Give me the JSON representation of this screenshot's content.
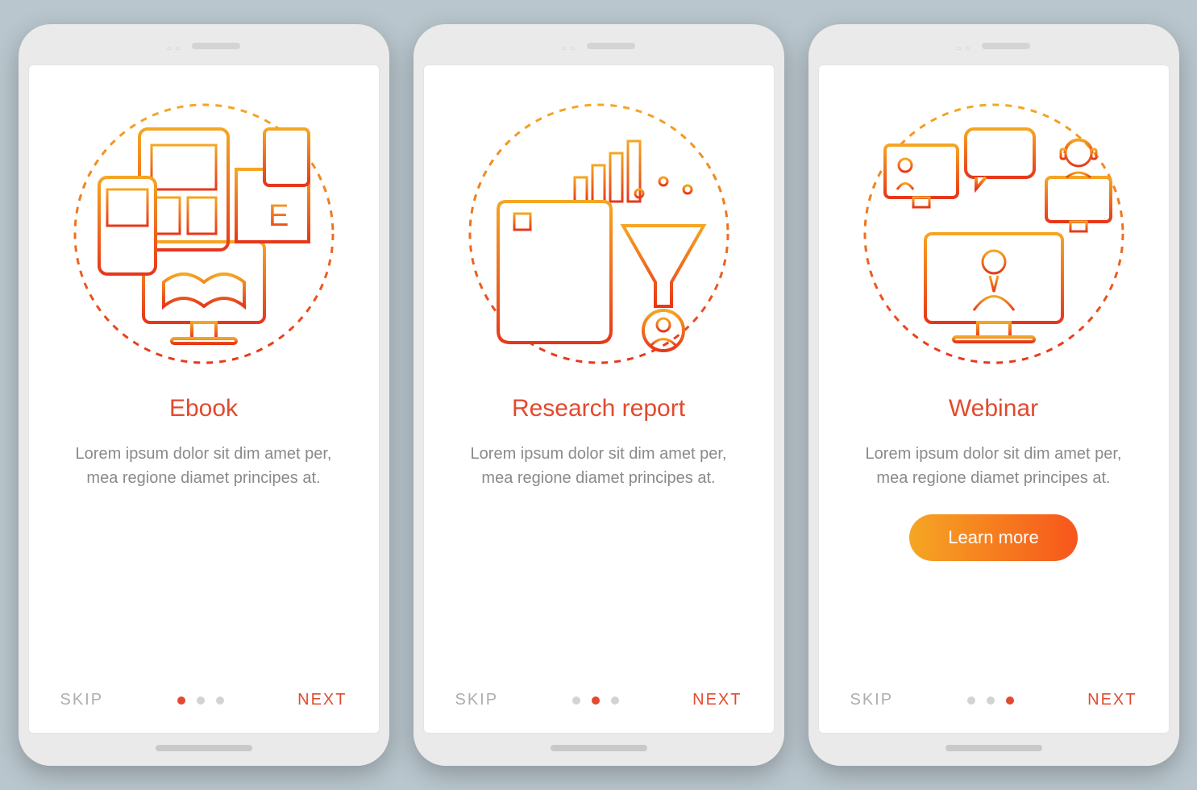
{
  "common": {
    "skip": "SKIP",
    "next": "NEXT",
    "body": "Lorem ipsum dolor sit dim amet per, mea regione diamet principes at."
  },
  "screens": [
    {
      "title": "Ebook",
      "active_step": 0,
      "icon": "ebook-illustration",
      "has_cta": false
    },
    {
      "title": "Research report",
      "active_step": 1,
      "icon": "research-illustration",
      "has_cta": false
    },
    {
      "title": "Webinar",
      "active_step": 2,
      "icon": "webinar-illustration",
      "has_cta": true,
      "cta_label": "Learn more"
    }
  ],
  "colors": {
    "accent_start": "#f5a623",
    "accent_end": "#f7561b",
    "text_accent": "#e24a2f",
    "text_muted": "#8a8a8a",
    "bg": "#b9c6cd"
  }
}
